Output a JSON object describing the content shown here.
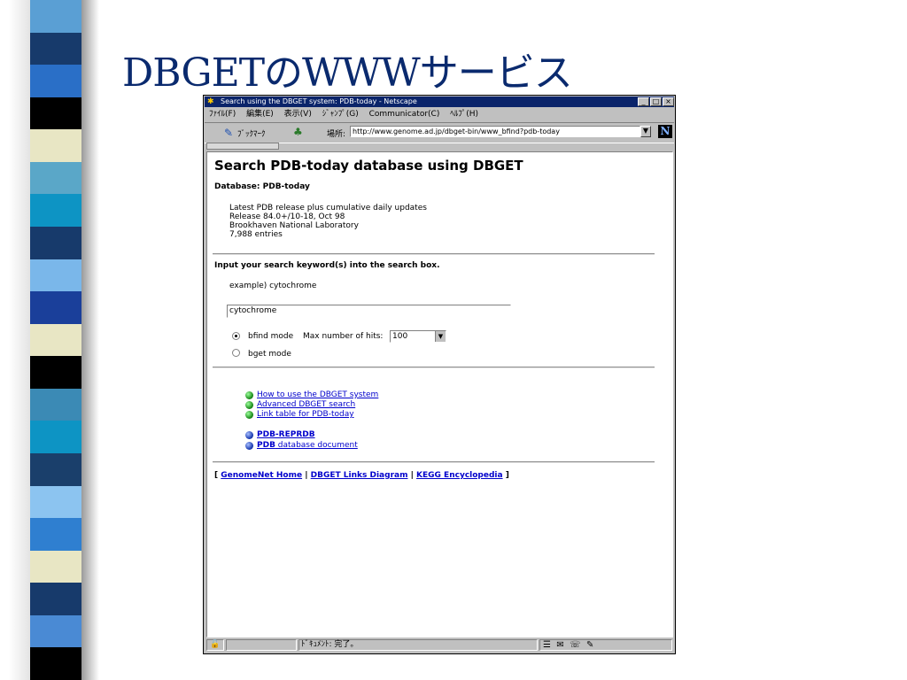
{
  "slide": {
    "title": "DBGETのWWWサービス",
    "stripe_colors": [
      "#5a9fd4",
      "#173a6b",
      "#2a6fc7",
      "#000000",
      "#e8e6c4",
      "#5aa7c8",
      "#0d94c4",
      "#173a6b",
      "#7ab7ea",
      "#1a3f9a",
      "#e8e6c4",
      "#000000",
      "#3b8ab5",
      "#0d94c4",
      "#1a3f6b",
      "#8cc4f0",
      "#2f7fd0",
      "#e8e6c4",
      "#173a6b",
      "#4a8ad4",
      "#000000"
    ]
  },
  "browser": {
    "title": "Search using the DBGET system: PDB-today - Netscape",
    "window_buttons": [
      "_",
      "□",
      "×"
    ],
    "menu": [
      "ﾌｧｲﾙ(F)",
      "編集(E)",
      "表示(V)",
      "ｼﾞｬﾝﾌﾟ(G)",
      "Communicator(C)",
      "ﾍﾙﾌﾟ(H)"
    ],
    "bookmarks_label": "ﾌﾞｯｸﾏｰｸ",
    "location_label": "場所:",
    "url": "http://www.genome.ad.jp/dbget-bin/www_bfind?pdb-today",
    "status_text": "ﾄﾞｷｭﾒﾝﾄ: 完了。"
  },
  "page": {
    "heading": "Search PDB-today database using DBGET",
    "database_label": "Database: PDB-today",
    "info_lines": [
      "Latest PDB release plus cumulative daily updates",
      "Release 84.0+/10-18, Oct 98",
      "Brookhaven National Laboratory",
      "7,988 entries"
    ],
    "input_prompt": "Input your search keyword(s) into the search box.",
    "example": "example)  cytochrome",
    "search_value": "cytochrome",
    "mode_bfind": "bfind mode",
    "max_hits_label": "Max number of hits:",
    "max_hits_value": "100",
    "mode_bget": "bget mode",
    "links": [
      "How to use the DBGET system",
      "Advanced DBGET search",
      "Link table for PDB-today"
    ],
    "pdb_reprdb": "PDB-REPRDB",
    "pdb_doc_bold": "PDB",
    "pdb_doc_rest": " database document",
    "footer_links": [
      "GenomeNet Home",
      "DBGET Links Diagram",
      "KEGG Encyclopedia"
    ]
  }
}
